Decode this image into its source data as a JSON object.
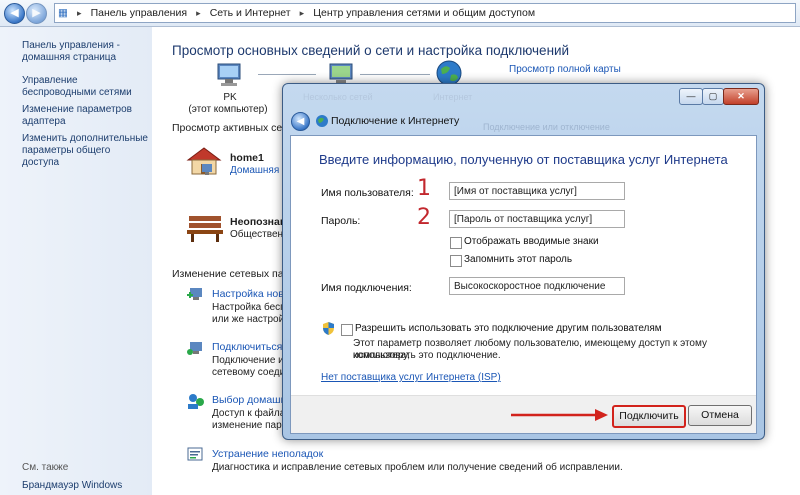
{
  "address_bar": {
    "crumbs": [
      "Панель управления",
      "Сеть и Интернет",
      "Центр управления сетями и общим доступом"
    ]
  },
  "sidebar": {
    "items": [
      "Панель управления - домашняя страница",
      "Управление беспроводными сетями",
      "Изменение параметров адаптера",
      "Изменить дополнительные параметры общего доступа"
    ],
    "see_also": "См. также",
    "firewall": "Брандмауэр Windows"
  },
  "main": {
    "title": "Просмотр основных сведений о сети и настройка подключений",
    "map_link": "Просмотр полной карты",
    "pc_name": "PK",
    "pc_sub": "(этот компьютер)",
    "active_networks": "Просмотр активных сетей",
    "network1_name": "home1",
    "network1_sub": "Домашняя",
    "network2_name": "Неопознан",
    "network2_sub": "Обществен",
    "change_settings": "Изменение сетевых парам",
    "items": [
      {
        "link": "Настройка новог",
        "desc1": "Настройка беспр",
        "desc2": "или же настройк"
      },
      {
        "link": "Подключиться к",
        "desc1": "Подключение ил",
        "desc2": "сетевому соедин"
      },
      {
        "link": "Выбор домашне",
        "desc1": "Доступ к файлам",
        "desc2": "изменение парам"
      },
      {
        "link": "Устранение неполадок",
        "desc1": "Диагностика и исправление сетевых проблем или получение сведений об исправлении.",
        "desc2": ""
      }
    ],
    "ghost1": "Несколько сетей",
    "ghost2": "Интернет",
    "ghost3": "Подключение или отключение"
  },
  "dialog": {
    "title": "Подключение к Интернету",
    "heading": "Введите информацию, полученную от поставщика услуг Интернета",
    "username_label": "Имя пользователя:",
    "username_value": "[Имя от поставщика услуг]",
    "password_label": "Пароль:",
    "password_value": "[Пароль от поставщика услуг]",
    "show_chars": "Отображать вводимые знаки",
    "remember": "Запомнить этот пароль",
    "conn_name_label": "Имя подключения:",
    "conn_name_value": "Высокоскоростное подключение",
    "allow_others": "Разрешить использовать это подключение другим пользователям",
    "allow_desc1": "Этот параметр позволяет любому пользователю, имеющему доступ к этому компьютеру,",
    "allow_desc2": "использовать это подключение.",
    "isp_link": "Нет поставщика услуг Интернета (ISP)",
    "connect_button": "Подключить",
    "cancel_button": "Отмена",
    "annot1": "1",
    "annot2": "2"
  }
}
